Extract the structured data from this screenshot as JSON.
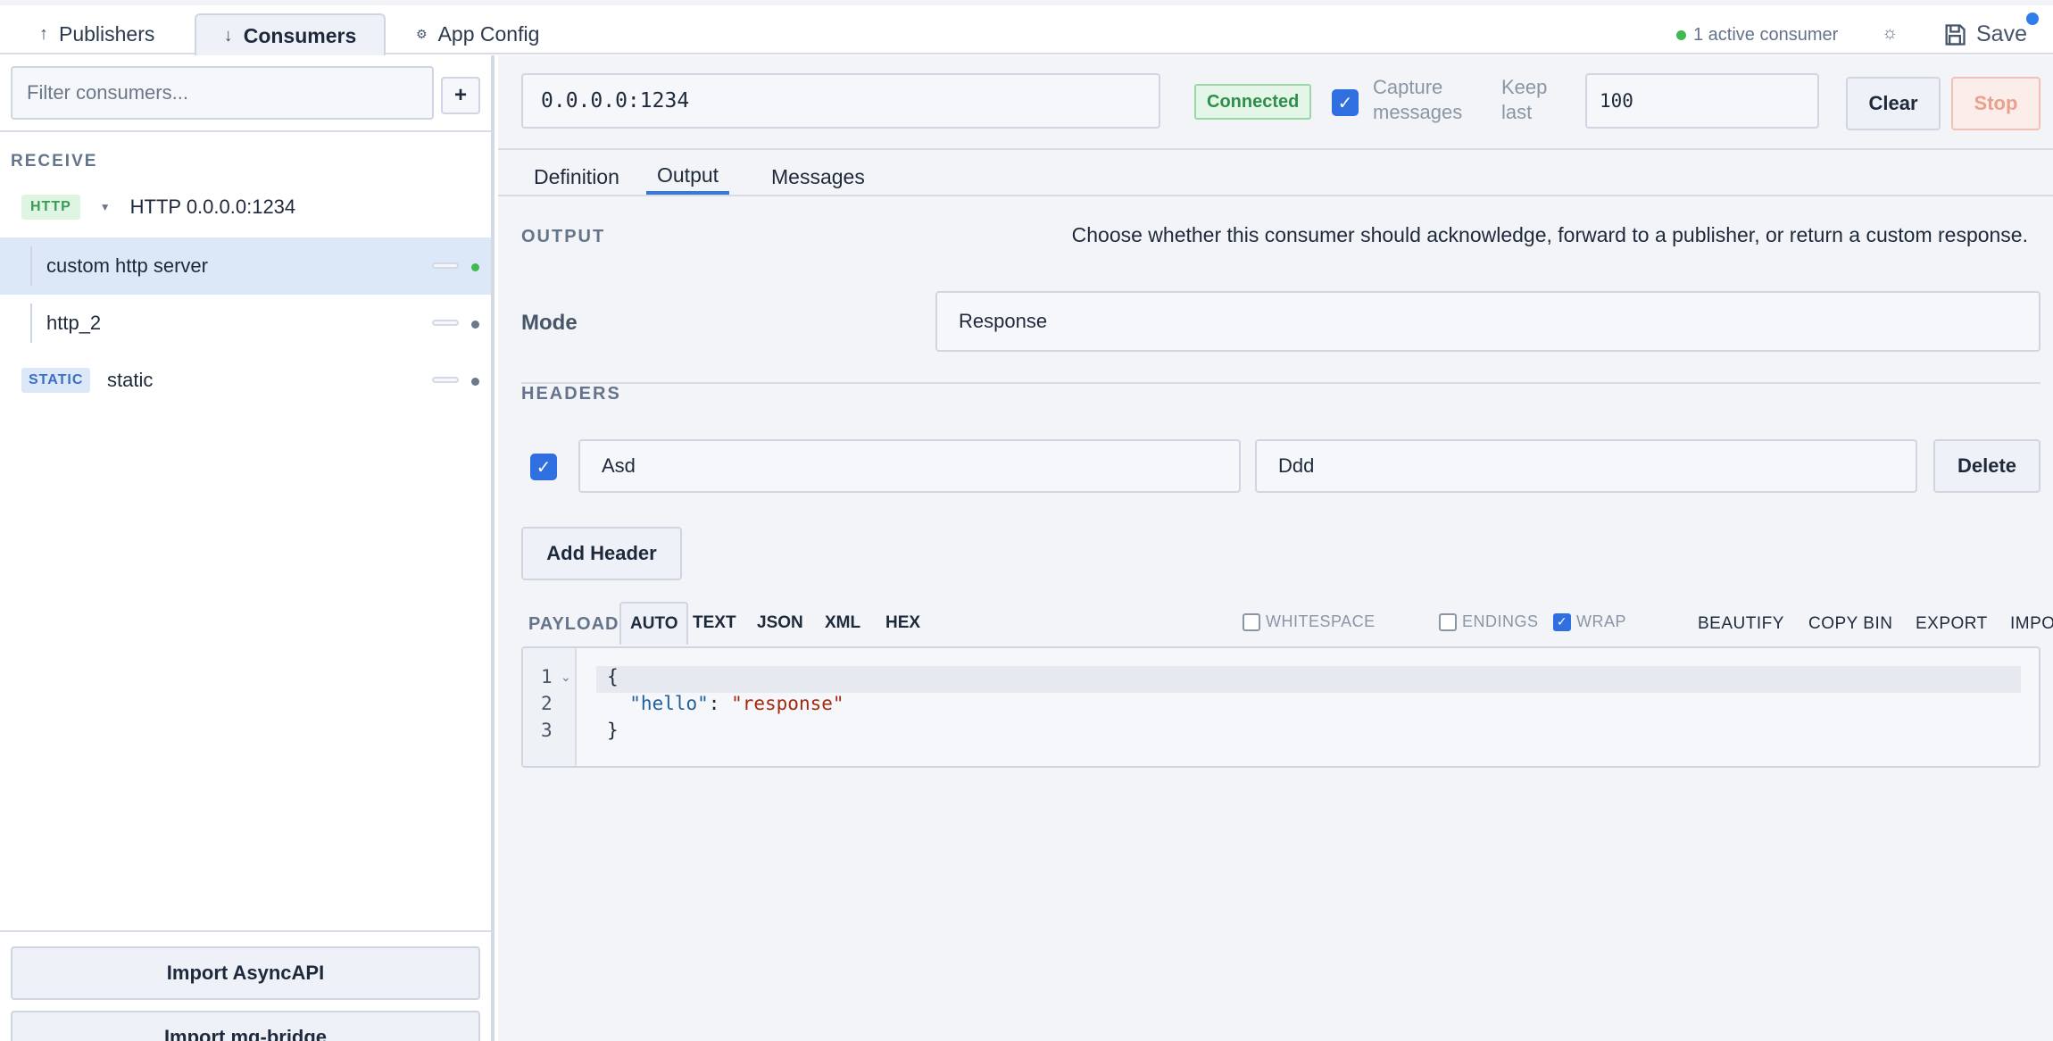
{
  "tabs": {
    "publishers": "Publishers",
    "consumers": "Consumers",
    "app_config": "App Config"
  },
  "header": {
    "active_consumers": "1 active consumer",
    "save": "Save"
  },
  "sidebar": {
    "filter_placeholder": "Filter consumers...",
    "add_label": "+",
    "section_label": "RECEIVE",
    "group": {
      "badge": "HTTP",
      "label": "HTTP 0.0.0.0:1234"
    },
    "items": [
      {
        "name": "custom http server",
        "status": "running"
      },
      {
        "name": "http_2",
        "status": "stopped"
      }
    ],
    "static_item": {
      "badge": "STATIC",
      "name": "static"
    },
    "buttons": {
      "import_asyncapi": "Import AsyncAPI",
      "import_mq_bridge": "Import mq-bridge"
    }
  },
  "connection": {
    "address": "0.0.0.0:1234",
    "status": "Connected",
    "capture_label": "Capture messages",
    "capture_checked": true,
    "keep_last_label": "Keep last",
    "keep_last_value": "100",
    "clear": "Clear",
    "stop": "Stop"
  },
  "subtabs": {
    "definition": "Definition",
    "output": "Output",
    "messages": "Messages",
    "active": "Output"
  },
  "output": {
    "section_label": "OUTPUT",
    "description": "Choose whether this consumer should acknowledge, forward to a publisher, or return a custom response.",
    "mode_label": "Mode",
    "mode_value": "Response"
  },
  "headers": {
    "section_label": "HEADERS",
    "rows": [
      {
        "enabled": true,
        "key": "Asd",
        "value": "Ddd",
        "delete": "Delete"
      }
    ],
    "add_button": "Add Header"
  },
  "payload": {
    "label": "PAYLOAD",
    "formats": [
      "AUTO",
      "TEXT",
      "JSON",
      "XML",
      "HEX"
    ],
    "active_format": "AUTO",
    "options": [
      {
        "label": "WHITESPACE",
        "checked": false
      },
      {
        "label": "ENDINGS",
        "checked": false
      },
      {
        "label": "WRAP",
        "checked": true
      }
    ],
    "actions": [
      "BEAUTIFY",
      "COPY BIN",
      "EXPORT",
      "IMPORT"
    ],
    "code_lines": [
      "{",
      "  \"hello\": \"response\"",
      "}"
    ],
    "line_numbers": [
      "1",
      "2",
      "3"
    ]
  },
  "colors": {
    "accent": "#2f6fe0",
    "connected": "#2f8f4a",
    "stop": "#e9a08d",
    "selected_row": "#dce7f8"
  }
}
